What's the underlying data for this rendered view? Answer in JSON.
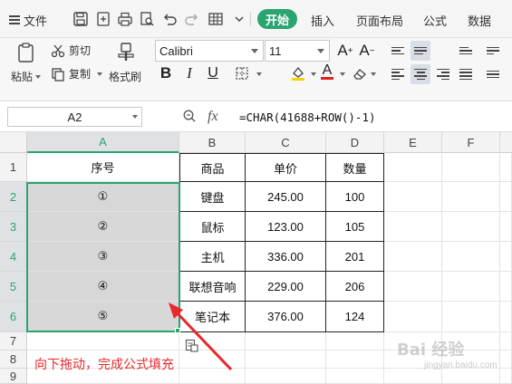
{
  "menubar": {
    "file_label": "文件",
    "tabs": [
      "开始",
      "插入",
      "页面布局",
      "公式",
      "数据"
    ],
    "active_tab": "开始"
  },
  "ribbon": {
    "cut_label": "剪切",
    "paste_label": "粘贴",
    "copy_label": "复制",
    "format_painter_label": "格式刷",
    "font_name": "Calibri",
    "font_size": "11",
    "bold_label": "B",
    "italic_label": "I",
    "underline_label": "U",
    "font_color_label": "A",
    "grow_font_label": "A+",
    "shrink_font_label": "A-",
    "fill_color": "#f5d300",
    "font_color": "#e02020"
  },
  "formula_bar": {
    "cell_ref": "A2",
    "fx_label": "fx",
    "formula": "=CHAR(41688+ROW()-1)"
  },
  "sheet": {
    "columns": [
      "A",
      "B",
      "C",
      "D",
      "E",
      "F"
    ],
    "rows": [
      "1",
      "2",
      "3",
      "4",
      "5",
      "6",
      "7",
      "8",
      "9"
    ],
    "selected_column": "A",
    "selected_rows": [
      "2",
      "3",
      "4",
      "5",
      "6"
    ],
    "headers": [
      "序号",
      "商品",
      "单价",
      "数量"
    ],
    "data": [
      [
        "①",
        "键盘",
        "245.00",
        "100"
      ],
      [
        "②",
        "鼠标",
        "123.00",
        "105"
      ],
      [
        "③",
        "主机",
        "336.00",
        "201"
      ],
      [
        "④",
        "联想音响",
        "229.00",
        "206"
      ],
      [
        "⑤",
        "笔记本",
        "376.00",
        "124"
      ]
    ],
    "accent_color": "#2aa471"
  },
  "annotation": {
    "text": "向下拖动，完成公式填充",
    "color": "#e8282b"
  },
  "watermark": {
    "text": "Bai 经验",
    "sub": "jingyan.baidu.com"
  }
}
